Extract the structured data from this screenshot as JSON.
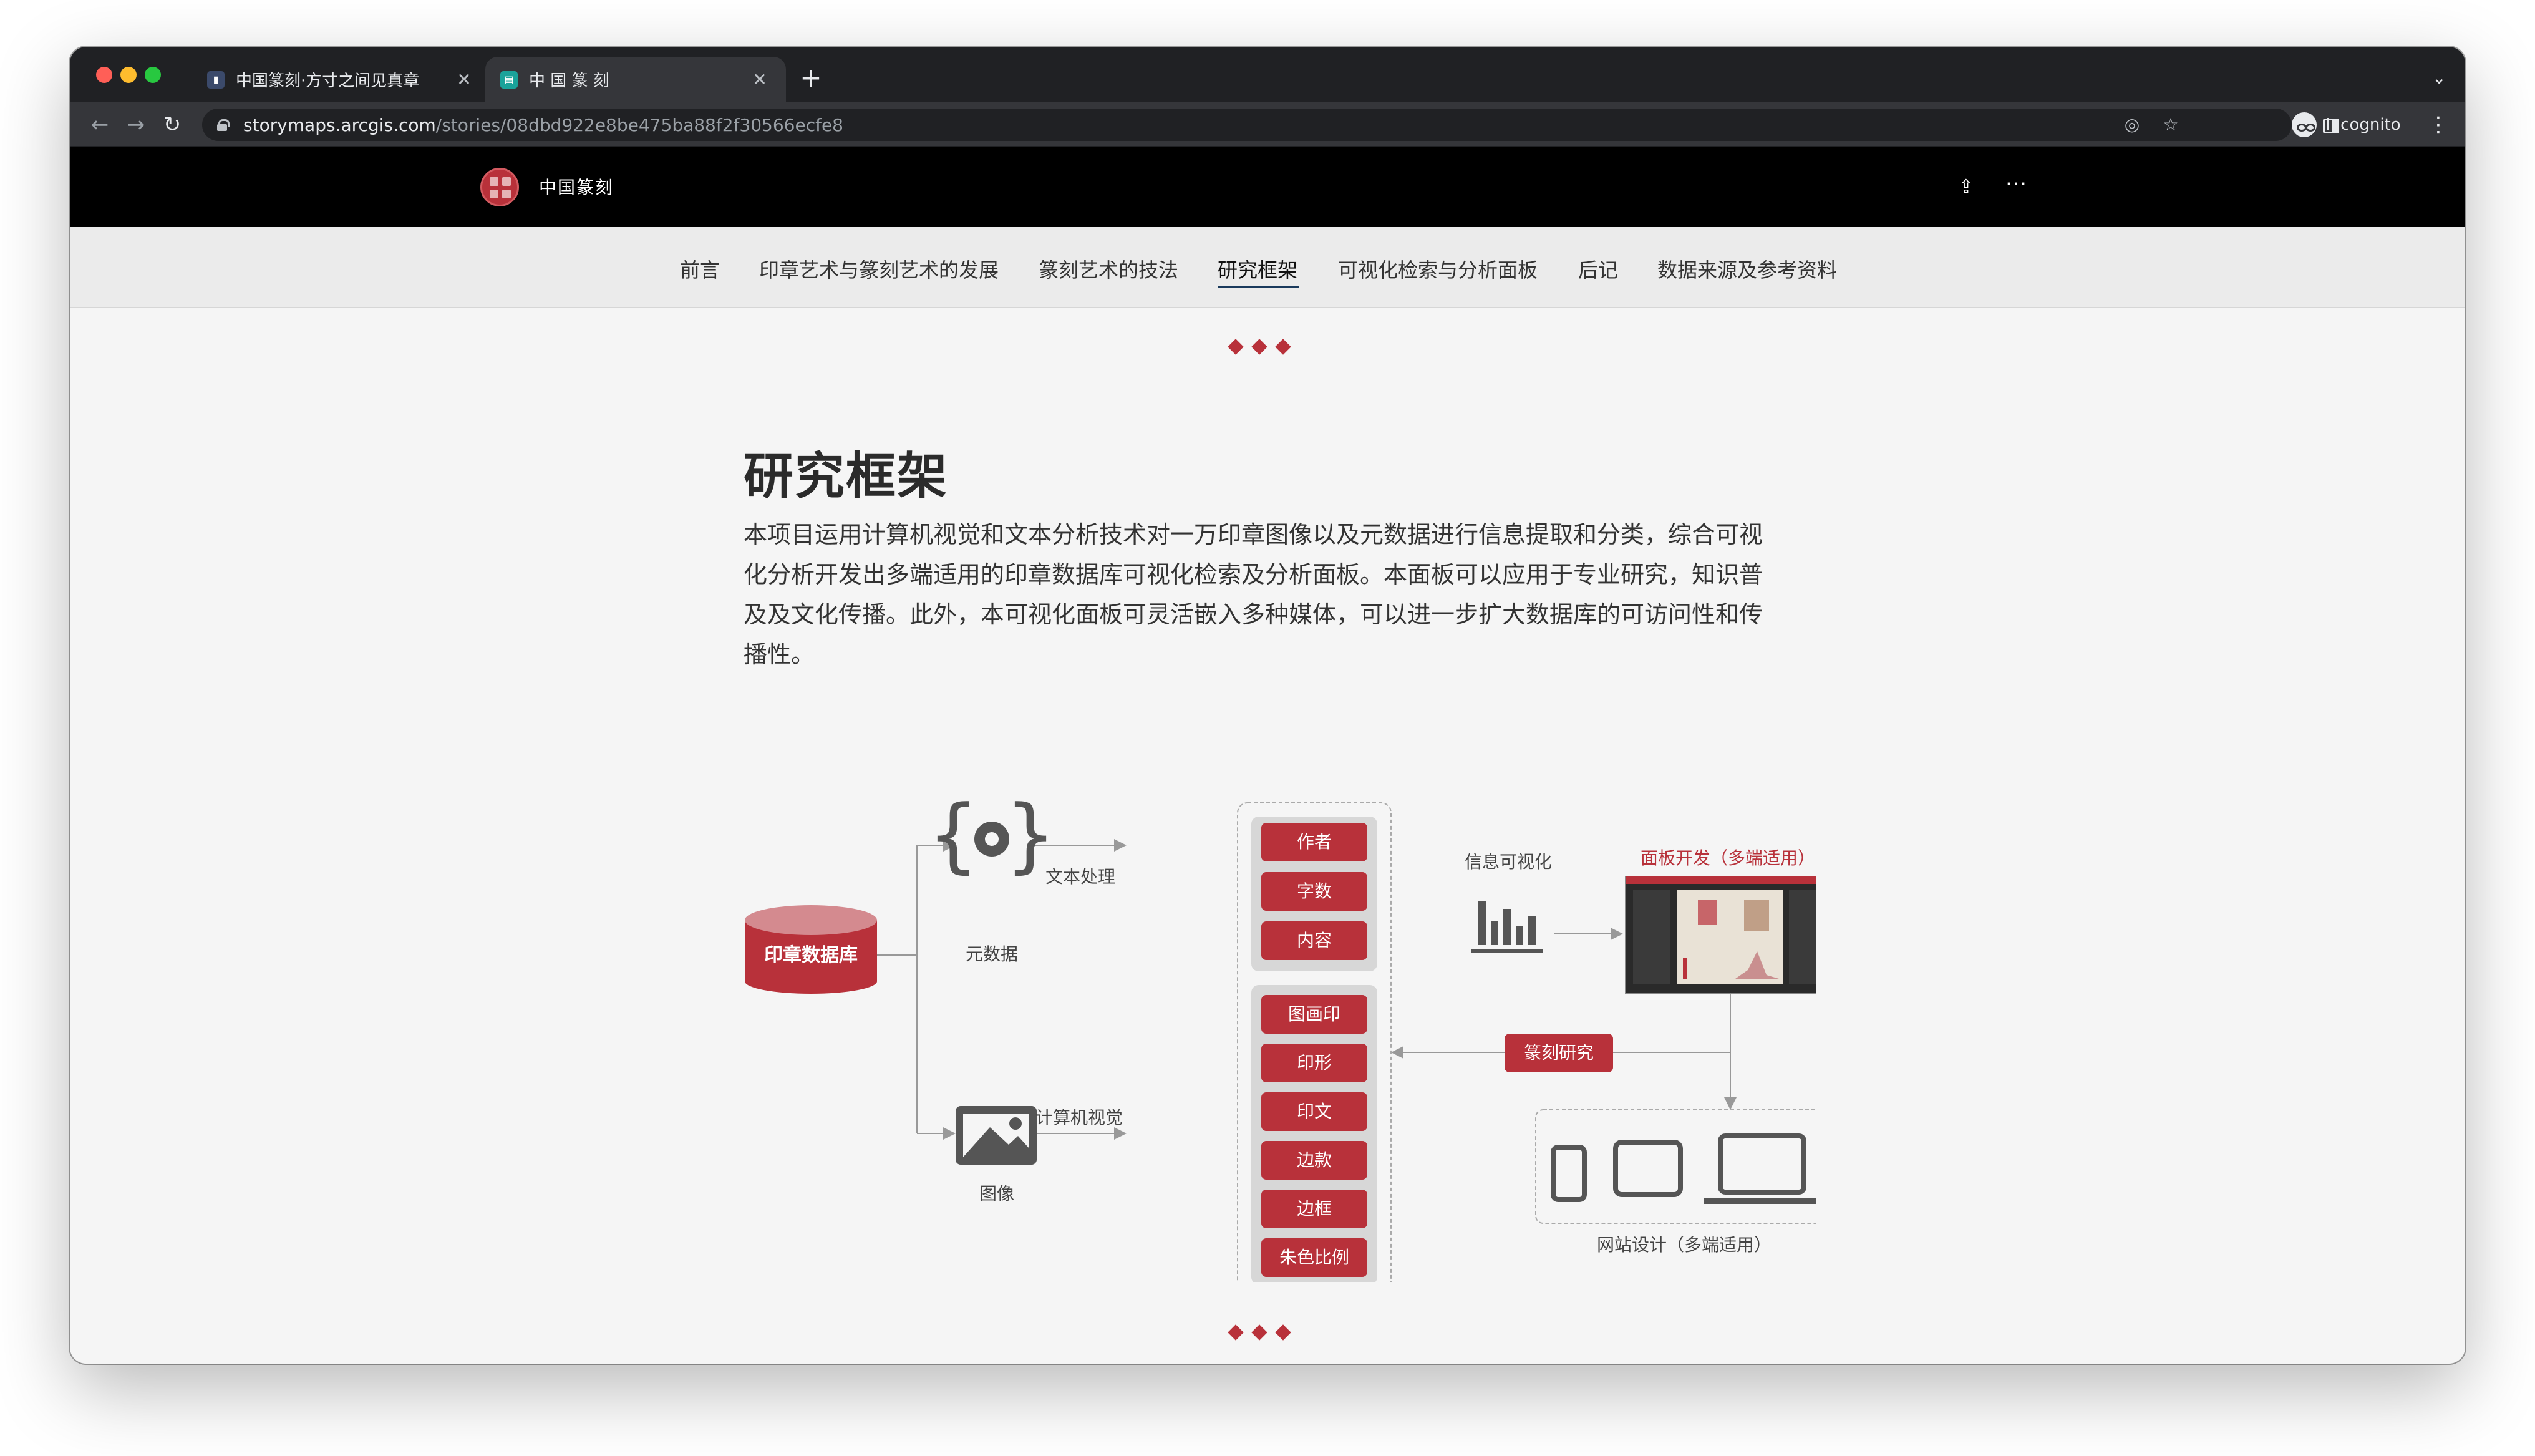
{
  "browser": {
    "tabs": [
      {
        "title": "中国篆刻·方寸之间见真章",
        "favicon": "chart-favicon"
      },
      {
        "title": "中 国 篆 刻",
        "favicon": "storymaps-favicon"
      }
    ],
    "new_tab_label": "+",
    "url_host": "storymaps.arcgis.com",
    "url_path": "/stories/08dbd922e8be475ba88f2f30566ecfe8",
    "profile_label": "Incognito"
  },
  "story": {
    "title": "中国篆刻",
    "nav": [
      {
        "label": "前言"
      },
      {
        "label": "印章艺术与篆刻艺术的发展"
      },
      {
        "label": "篆刻艺术的技法"
      },
      {
        "label": "研究框架"
      },
      {
        "label": "可视化检索与分析面板"
      },
      {
        "label": "后记"
      },
      {
        "label": "数据来源及参考资料"
      }
    ],
    "active_nav": "研究框架",
    "heading": "研究框架",
    "paragraph": "本项目运用计算机视觉和文本分析技术对一万印章图像以及元数据进行信息提取和分类，综合可视化分析开发出多端适用的印章数据库可视化检索及分析面板。本面板可以应用于专业研究，知识普及及文化传播。此外，本可视化面板可灵活嵌入多种媒体，可以进一步扩大数据库的可访问性和传播性。"
  },
  "diagram": {
    "database": "印章数据库",
    "metadata": "元数据",
    "image": "图像",
    "text_processing": "文本处理",
    "computer_vision": "计算机视觉",
    "meta_fields": [
      "作者",
      "字数",
      "内容"
    ],
    "image_fields": [
      "图画印",
      "印形",
      "印文",
      "边款",
      "边框",
      "朱色比例"
    ],
    "info_vis": "信息可视化",
    "dashboard_dev": "面板开发（多端适用）",
    "seal_research": "篆刻研究",
    "web_design": "网站设计（多端适用）"
  },
  "colors": {
    "accent": "#b8313a",
    "nav_underline": "#1a3a5c",
    "header_bg": "#000000"
  }
}
